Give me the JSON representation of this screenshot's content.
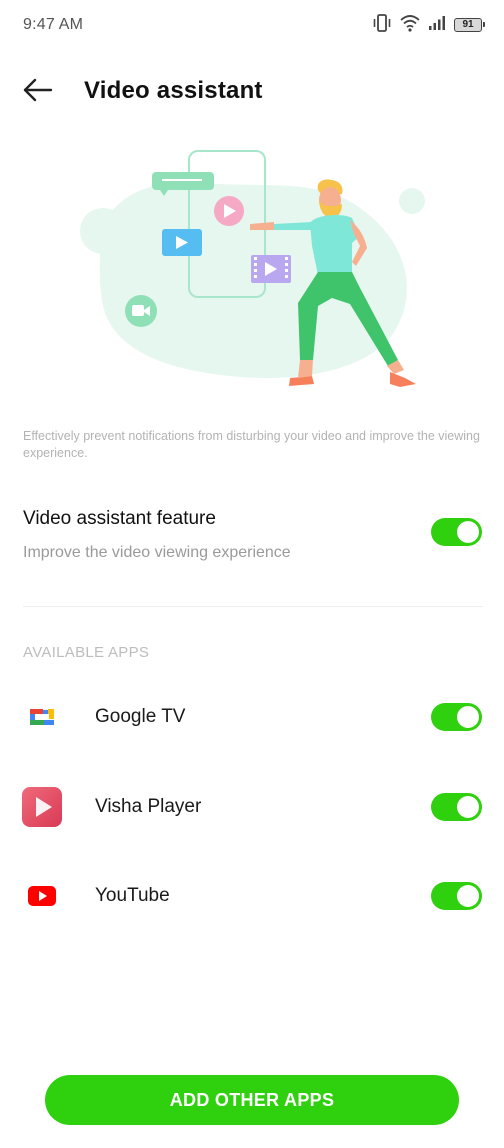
{
  "status_bar": {
    "time": "9:47 AM",
    "battery_level": "91",
    "icons": [
      "vibrate-icon",
      "wifi-icon",
      "signal-icon",
      "battery-icon"
    ]
  },
  "header": {
    "title": "Video assistant",
    "back_icon": "back-arrow-icon"
  },
  "description": "Effectively prevent notifications from disturbing your video and improve the viewing experience.",
  "feature": {
    "title": "Video assistant feature",
    "subtitle": "Improve the video viewing experience",
    "enabled": true
  },
  "apps_section": {
    "label": "AVAILABLE APPS",
    "apps": [
      {
        "name": "Google TV",
        "icon": "google-tv-icon",
        "enabled": true
      },
      {
        "name": "Visha Player",
        "icon": "visha-player-icon",
        "enabled": true
      },
      {
        "name": "YouTube",
        "icon": "youtube-icon",
        "enabled": true
      }
    ]
  },
  "add_button_label": "ADD OTHER APPS",
  "colors": {
    "accent": "#2fd10f",
    "illustration_blob": "#e3f6ef",
    "illustration_outline": "#a8e6cc",
    "play_pink": "#f4a6c3",
    "play_blue": "#56bdf3",
    "film_purple": "#b7a6ef",
    "person_shirt": "#7fe7d8",
    "person_pants": "#3fc36b",
    "person_hair": "#f6c24a",
    "person_skin": "#f7a27f"
  }
}
